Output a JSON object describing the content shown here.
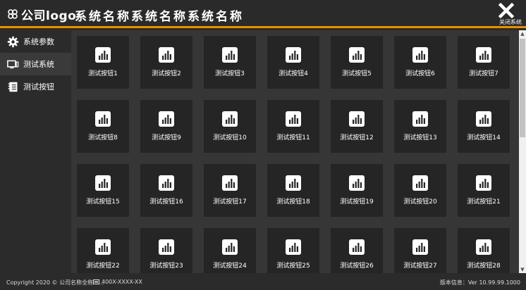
{
  "header": {
    "logo_text": "公司logo",
    "system_name": "系统名称系统名称系统名称",
    "close_label": "关闭系统"
  },
  "sidebar": {
    "items": [
      {
        "label": "系统参数",
        "icon": "gear-icon"
      },
      {
        "label": "测试系统",
        "icon": "monitor-icon"
      },
      {
        "label": "测试按钮",
        "icon": "notebook-icon"
      }
    ]
  },
  "main": {
    "tiles": [
      {
        "label": "测试按钮1"
      },
      {
        "label": "测试按钮2"
      },
      {
        "label": "测试按钮3"
      },
      {
        "label": "测试按钮4"
      },
      {
        "label": "测试按钮5"
      },
      {
        "label": "测试按钮6"
      },
      {
        "label": "测试按钮7"
      },
      {
        "label": "测试按钮8"
      },
      {
        "label": "测试按钮9"
      },
      {
        "label": "测试按钮10"
      },
      {
        "label": "测试按钮11"
      },
      {
        "label": "测试按钮12"
      },
      {
        "label": "测试按钮13"
      },
      {
        "label": "测试按钮14"
      },
      {
        "label": "测试按钮15"
      },
      {
        "label": "测试按钮16"
      },
      {
        "label": "测试按钮17"
      },
      {
        "label": "测试按钮18"
      },
      {
        "label": "测试按钮19"
      },
      {
        "label": "测试按钮20"
      },
      {
        "label": "测试按钮21"
      },
      {
        "label": "测试按钮22"
      },
      {
        "label": "测试按钮23"
      },
      {
        "label": "测试按钮24"
      },
      {
        "label": "测试按钮25"
      },
      {
        "label": "测试按钮26"
      },
      {
        "label": "测试按钮27"
      },
      {
        "label": "测试按钮28"
      }
    ],
    "tile_icon": "bar-chart-icon"
  },
  "footer": {
    "copyright": "Copyright 2020 © 公司名称全称......",
    "phone": "400X-XXXX-XX",
    "version": "版本信息：Ver 10.99.99.1000"
  },
  "colors": {
    "accent": "#f08c00",
    "background": "#2b2b2b",
    "content_background": "#363636",
    "tile_background": "#252525"
  }
}
